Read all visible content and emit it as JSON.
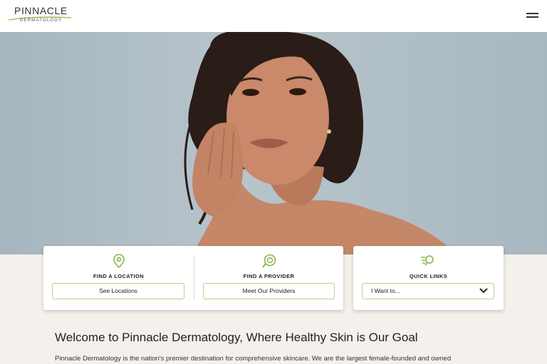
{
  "header": {
    "logo_main": "PINNACLE",
    "logo_sub": "DERMATOLOGY",
    "menu_icon": "hamburger-menu-icon"
  },
  "hero": {
    "image": "woman-touching-face-photo"
  },
  "cards": {
    "location": {
      "title": "FIND A LOCATION",
      "button": "See Locations",
      "icon": "map-pin-icon"
    },
    "provider": {
      "title": "FIND A PROVIDER",
      "button": "Meet Our Providers",
      "icon": "provider-search-icon"
    },
    "quick_links": {
      "title": "QUICK LINKS",
      "selected": "I Want to...",
      "icon": "quick-links-search-icon"
    }
  },
  "main": {
    "heading": "Welcome to Pinnacle Dermatology, Where Healthy Skin is Our Goal",
    "intro": "Pinnacle Dermatology is the nation's premier destination for comprehensive skincare. We are the largest female-founded and owned"
  },
  "colors": {
    "accent": "#8cb34a",
    "accent_light": "#b9d08c",
    "background": "#f4f0ec"
  }
}
